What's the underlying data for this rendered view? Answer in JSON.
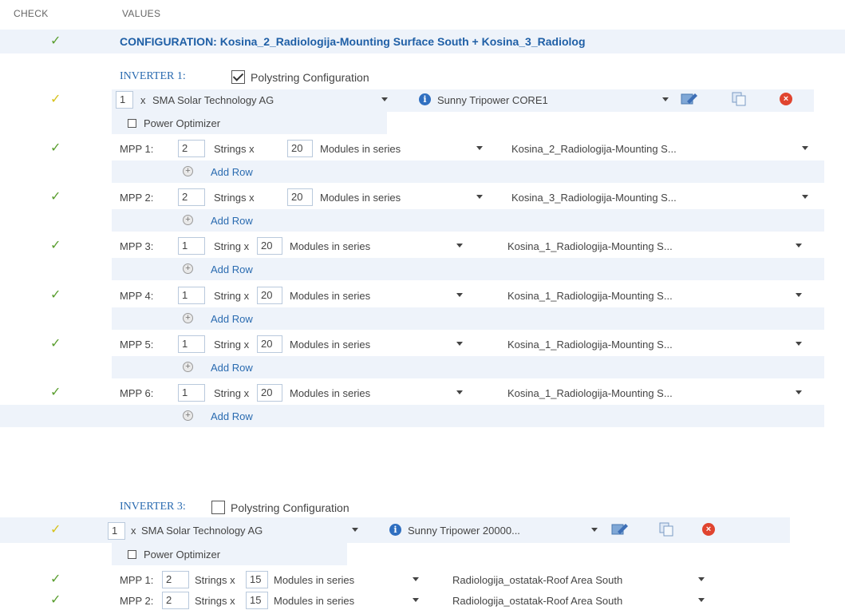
{
  "header": {
    "check": "CHECK",
    "values": "VALUES"
  },
  "configuration": {
    "title": "CONFIGURATION: Kosina_2_Radiologija-Mounting Surface South + Kosina_3_Radiolog"
  },
  "common": {
    "add_row": "Add Row",
    "multiply": "x",
    "power_optimizer": "Power Optimizer",
    "polystring": "Polystring Configuration",
    "modules_in_series": "Modules in series"
  },
  "inverter1": {
    "label": "INVERTER 1:",
    "polystring_checked": true,
    "count": "1",
    "manufacturer": "SMA Solar Technology AG",
    "model": "Sunny Tripower CORE1",
    "mpps": [
      {
        "label": "MPP 1:",
        "strings": "2",
        "strings_unit": "Strings x",
        "modules": "20",
        "surface": "Kosina_2_Radiologija-Mounting S..."
      },
      {
        "label": "MPP 2:",
        "strings": "2",
        "strings_unit": "Strings x",
        "modules": "20",
        "surface": "Kosina_3_Radiologija-Mounting S..."
      },
      {
        "label": "MPP 3:",
        "strings": "1",
        "strings_unit": "String x",
        "modules": "20",
        "surface": "Kosina_1_Radiologija-Mounting S..."
      },
      {
        "label": "MPP 4:",
        "strings": "1",
        "strings_unit": "String x",
        "modules": "20",
        "surface": "Kosina_1_Radiologija-Mounting S..."
      },
      {
        "label": "MPP 5:",
        "strings": "1",
        "strings_unit": "String x",
        "modules": "20",
        "surface": "Kosina_1_Radiologija-Mounting S..."
      },
      {
        "label": "MPP 6:",
        "strings": "1",
        "strings_unit": "String x",
        "modules": "20",
        "surface": "Kosina_1_Radiologija-Mounting S..."
      }
    ]
  },
  "inverter3": {
    "label": "INVERTER 3:",
    "polystring_checked": false,
    "count": "1",
    "manufacturer": "SMA Solar Technology AG",
    "model": "Sunny Tripower 20000...",
    "mpps": [
      {
        "label": "MPP 1:",
        "strings": "2",
        "strings_unit": "Strings x",
        "modules": "15",
        "surface": "Radiologija_ostatak-Roof Area South"
      },
      {
        "label": "MPP 2:",
        "strings": "2",
        "strings_unit": "Strings x",
        "modules": "15",
        "surface": "Radiologija_ostatak-Roof Area South"
      }
    ]
  },
  "colors": {
    "accent_blue": "#1f5fa6",
    "check_green": "#5a9e2f",
    "check_yellow": "#d6c21a",
    "row_band": "#eef3fa"
  },
  "icons": {
    "check": "✓",
    "info": "i",
    "delete": "×",
    "add": "+"
  }
}
